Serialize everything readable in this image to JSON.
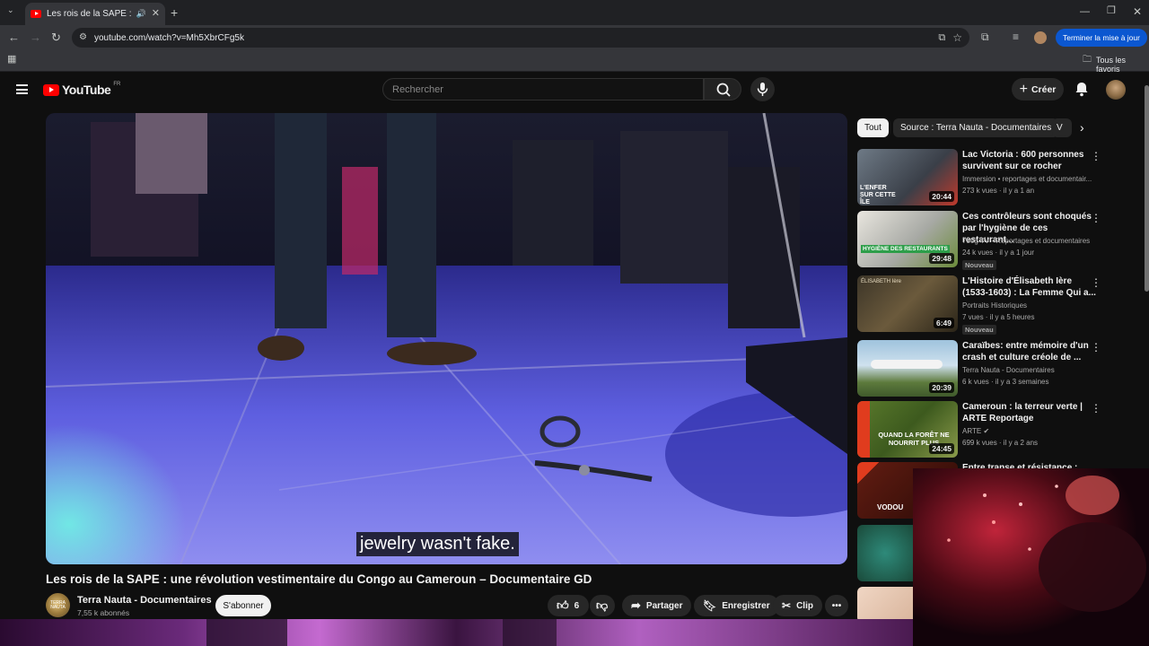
{
  "browser": {
    "tab_title": "Les rois de la SAPE : une ré",
    "url": "youtube.com/watch?v=Mh5XbrCFg5k",
    "update_button": "Terminer la mise à jour",
    "bookmarks_label": "Tous les favoris"
  },
  "youtube": {
    "logo_text": "YouTube",
    "country": "FR",
    "search_placeholder": "Rechercher",
    "create_label": "Créer"
  },
  "player": {
    "caption": "jewelry wasn't fake."
  },
  "video": {
    "title": "Les rois de la SAPE : une révolution vestimentaire du Congo au Cameroun – Documentaire GD",
    "channel": "Terra Nauta - Documentaires",
    "subscribers": "7,55 k abonnés",
    "subscribe": "S'abonner",
    "likes": "6",
    "share": "Partager",
    "save": "Enregistrer",
    "clip": "Clip",
    "avatar_text": "TERRA NAUTA"
  },
  "chips": [
    "Tout",
    "Source : Terra Nauta - Documentaires",
    "V"
  ],
  "recommendations": [
    {
      "title": "Lac Victoria : 600 personnes survivent sur ce rocher",
      "channel": "Immersion",
      "channel_extra": "reportages et documentair...",
      "meta": "273 k vues · il y a 1 an",
      "duration": "20:44",
      "badge": "",
      "thumb_text": "L'ENFER SUR CETTE ÎLE"
    },
    {
      "title": "Ces contrôleurs sont choqués par l'hygiène de ces restaurant...",
      "channel": "750g TV - Reportages et documentaires",
      "channel_extra": "",
      "meta": "24 k vues · il y a 1 jour",
      "duration": "29:48",
      "badge": "Nouveau",
      "thumb_text": "HYGIÈNE DES RESTAURANTS"
    },
    {
      "title": "L'Histoire d'Élisabeth Ière (1533-1603) : La Femme Qui a...",
      "channel": "Portraits Historiques",
      "channel_extra": "",
      "meta": "7 vues · il y a 5 heures",
      "duration": "6:49",
      "badge": "Nouveau",
      "thumb_text": "ÉLISABETH Ière"
    },
    {
      "title": "Caraïbes: entre mémoire d'un crash et culture créole de ...",
      "channel": "Terra Nauta - Documentaires",
      "channel_extra": "",
      "meta": "6 k vues · il y a 3 semaines",
      "duration": "20:39",
      "badge": "",
      "thumb_text": ""
    },
    {
      "title": "Cameroun : la terreur verte | ARTE Reportage",
      "channel": "ARTE",
      "channel_extra": "",
      "meta": "699 k vues · il y a 2 ans",
      "duration": "24:45",
      "badge": "",
      "thumb_text": "QUAND LA FORÊT NE NOURRIT PLUS"
    },
    {
      "title": "Entre transe et résistance :",
      "channel": "",
      "channel_extra": "",
      "meta": "",
      "duration": "",
      "badge": "",
      "thumb_text": "VODOU"
    }
  ]
}
